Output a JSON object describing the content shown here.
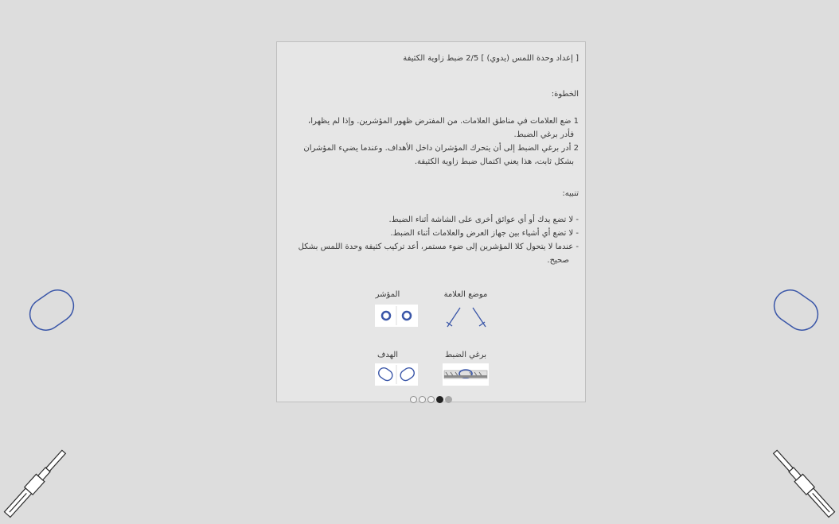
{
  "header": {
    "title": "[ إعداد وحدة اللمس (يدوي) ]  2/5 ضبط زاوية الكثيفة"
  },
  "steps": {
    "heading": "الخطوة:",
    "lines": [
      "1 ضع العلامات في مناطق العلامات. من المفترض ظهور المؤشرين. وإذا لم يظهرا،",
      "فأدر برغي الضبط.",
      "2 أدر برغي الضبط إلى أن يتحرك المؤشران داخل الأهداف. وعندما يضيء المؤشران",
      "بشكل ثابت، هذا يعني اكتمال ضبط زاوية الكثيفة."
    ]
  },
  "notes": {
    "heading": "تنبيه:",
    "lines": [
      "- لا تضع يدك أو أي عوائق أخرى على الشاشة أثناء الضبط.",
      "- لا تضع أي أشياء بين جهاز العرض والعلامات أثناء الضبط.",
      "- عندما لا يتحول كلا المؤشرين إلى ضوء مستمر، أعد تركيب كثيفة وحدة اللمس بشكل",
      "صحيح."
    ]
  },
  "legend": {
    "mark_position": "موضع العلامة",
    "indicator": "المؤشر",
    "adjust_screw": "برغي الضبط",
    "target": "الهدف"
  },
  "pagination": {
    "total": 5,
    "current": 4
  },
  "colors": {
    "accent": "#3a56a8",
    "background": "#dddddd",
    "panel": "#e6e6e6"
  }
}
